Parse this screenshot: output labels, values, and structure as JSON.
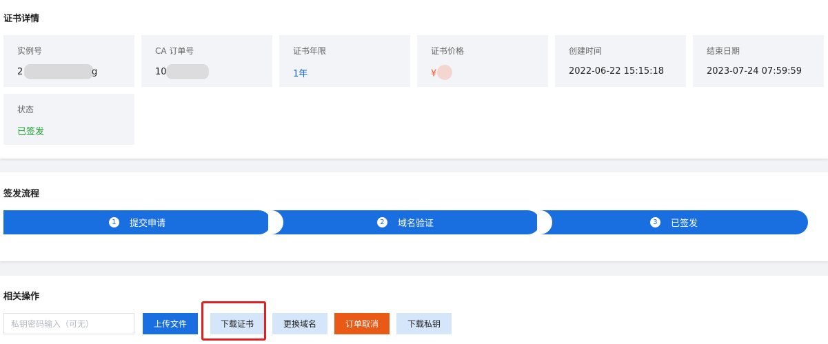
{
  "cert_details": {
    "title": "证书详情",
    "items": [
      {
        "label": "实例号",
        "value": "2▇▇▇▇▇▇▇▇g"
      },
      {
        "label": "CA 订单号",
        "value": "10▇▇▇▇▇▇"
      },
      {
        "label": "证书年限",
        "value": "1年"
      },
      {
        "label": "证书价格",
        "value": "¥"
      },
      {
        "label": "创建时间",
        "value": "2022-06-22 15:15:18"
      },
      {
        "label": "结束日期",
        "value": "2023-07-24 07:59:59"
      },
      {
        "label": "状态",
        "value": "已签发"
      }
    ]
  },
  "issue_flow": {
    "title": "签发流程",
    "steps": [
      {
        "number": "1",
        "label": "提交申请"
      },
      {
        "number": "2",
        "label": "域名验证"
      },
      {
        "number": "3",
        "label": "已签发"
      }
    ]
  },
  "actions": {
    "title": "相关操作",
    "password_placeholder": "私钥密码输入（可无）",
    "upload_file": "上传文件",
    "download_cert": "下载证书",
    "change_domain": "更换域名",
    "cancel_order": "订单取消",
    "download_key": "下载私钥"
  },
  "colors": {
    "primary": "#1a6fe0",
    "light_button": "#d5e6fb",
    "danger": "#ea5a17",
    "status_green": "#1aa32b",
    "price_orange": "#e8582b",
    "highlight_red": "#e02020"
  }
}
